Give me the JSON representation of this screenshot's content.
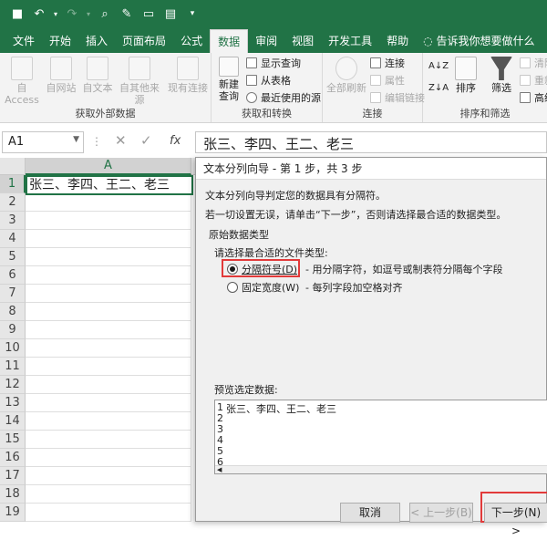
{
  "quick_access": {
    "icons": [
      "save-icon",
      "undo-icon",
      "redo-icon",
      "print-preview-icon",
      "paint-icon",
      "comment-icon",
      "comment-filter-icon",
      "customize-icon"
    ]
  },
  "tabs": [
    "文件",
    "开始",
    "插入",
    "页面布局",
    "公式",
    "数据",
    "审阅",
    "视图",
    "开发工具",
    "帮助",
    "告诉我你想要做什么"
  ],
  "active_tab": "数据",
  "ribbon": {
    "get_external": {
      "label": "获取外部数据",
      "buttons": [
        "自 Access",
        "自网站",
        "自文本",
        "自其他来源",
        "现有连接"
      ]
    },
    "get_transform": {
      "label": "获取和转换",
      "new_query": "新建",
      "new_query2": "查询",
      "show_queries": "显示查询",
      "from_table": "从表格",
      "recent_sources": "最近使用的源"
    },
    "connections": {
      "label": "连接",
      "refresh_all": "全部刷新",
      "connections": "连接",
      "properties": "属性",
      "edit_links": "编辑链接"
    },
    "sort_filter": {
      "label": "排序和筛选",
      "sort": "排序",
      "filter": "筛选",
      "clear": "清除",
      "reapply": "重新",
      "advanced": "高级"
    }
  },
  "formula_bar": {
    "name_box": "A1",
    "fx": "fx",
    "value": "张三、李四、王二、老三"
  },
  "sheet": {
    "column": "A",
    "rows": [
      "1",
      "2",
      "3",
      "4",
      "5",
      "6",
      "7",
      "8",
      "9",
      "10",
      "11",
      "12",
      "13",
      "14",
      "15",
      "16",
      "17",
      "18",
      "19"
    ],
    "a1": "张三、李四、王二、老三"
  },
  "dialog": {
    "title": "文本分列向导 - 第 1 步，共 3 步",
    "intro1": "文本分列向导判定您的数据具有分隔符。",
    "intro2": "若一切设置无误，请单击“下一步”，否则请选择最合适的数据类型。",
    "section": "原始数据类型",
    "prompt": "请选择最合适的文件类型:",
    "option1": "分隔符号(D)",
    "option1_desc": "- 用分隔字符，如逗号或制表符分隔每个字段",
    "option2": "固定宽度(W)",
    "option2_desc": "- 每列字段加空格对齐",
    "preview_label": "预览选定数据:",
    "preview_lines": [
      "1",
      "2",
      "3",
      "4",
      "5",
      "6"
    ],
    "preview_text": "张三、李四、王二、老三",
    "cancel": "取消",
    "back": "< 上一步(B)",
    "next": "下一步(N) >"
  }
}
